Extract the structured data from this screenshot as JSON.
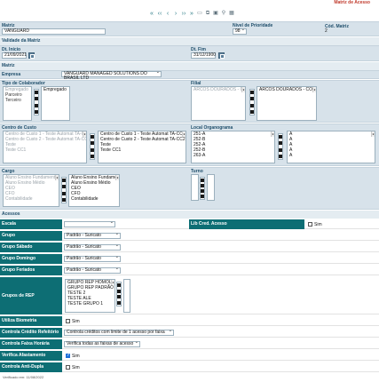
{
  "header": {
    "title": "Matriz de Acesso"
  },
  "toolbar": {
    "first": "«",
    "prev2": "‹‹",
    "prev": "‹",
    "next": "›",
    "next2": "››",
    "last": "»",
    "new_doc_icon": "document-icon",
    "copy_icon": "copy-icon",
    "save_icon": "save-icon",
    "search_icon": "search-icon",
    "export_icon": "export-icon"
  },
  "matriz": {
    "label": "Matriz",
    "value": "VANGUARD"
  },
  "nivel": {
    "label": "Nível de Prioridade",
    "value": "98"
  },
  "cod_matriz": {
    "label": "Cód. Matriz",
    "value": "2"
  },
  "validade": {
    "label": "Validade da Matriz"
  },
  "dt_inicio": {
    "label": "Dt. Início",
    "value": "21/09/2021"
  },
  "dt_fim": {
    "label": "Dt. Fim",
    "value": "31/12/1900"
  },
  "matriz_section": {
    "label": "Matriz"
  },
  "empresa": {
    "label": "Empresa",
    "value": "VANGUARD MANAGED SOLUTIONS DO BRASIL LTD"
  },
  "tipo_colab": {
    "label": "Tipo de Colaborador",
    "available": [
      "Empregado",
      "Parceiro",
      "Terceiro"
    ],
    "selected": [
      "Empregado"
    ]
  },
  "filial": {
    "label": "Filial",
    "available": [
      "ARCOS DOURADOS - CORP"
    ],
    "selected": [
      "ARCOS DOURADOS - CORP"
    ]
  },
  "centro_custo": {
    "label": "Centro de Custo",
    "available": [
      "Centro de Custo 1 - Teste Automat TA-CC1",
      "Centro de Custo 2 - Teste Automat TA-CC2",
      "Teste",
      "Teste CC1"
    ],
    "selected": [
      "Centro de Custo 1 - Teste Automat TA-CC1",
      "Centro de Custo 2 - Teste Automat TA-CC2",
      "Teste",
      "Teste CC1"
    ]
  },
  "local_org": {
    "label": "Local Organograma",
    "available": [
      "251-A",
      "252-B",
      "252-A",
      "252-B",
      "263-A"
    ],
    "selected": [
      "A",
      "A",
      "A",
      "A",
      "A"
    ]
  },
  "cargo": {
    "label": "Cargo",
    "available": [
      "Aluno Ensino Fundamental",
      "Aluno Ensino Médio",
      "CEO",
      "CFO",
      "Contabilidade"
    ],
    "selected": [
      "Aluno Ensino Fundamental",
      "Aluno Ensino Médio",
      "CEO",
      "CFO",
      "Contabilidade"
    ]
  },
  "turno": {
    "label": "Turno"
  },
  "acessos": {
    "label": "Acessos"
  },
  "escala": {
    "label": "Escala",
    "value": ""
  },
  "lib_cred": {
    "label": "Lib Cred. Acesso",
    "check_label": "Sim"
  },
  "grupo": {
    "label": "Grupo",
    "value": "Padrão - Suricato"
  },
  "grupo_sabado": {
    "label": "Grupo Sábado",
    "value": "Padrão - Suricato"
  },
  "grupo_domingo": {
    "label": "Grupo Domingo",
    "value": "Padrão - Suricato"
  },
  "grupo_feriados": {
    "label": "Grupo Feriados",
    "value": "Padrão - Suricato"
  },
  "grupos_rep": {
    "label": "Grupos de REP",
    "items": [
      "GRUPO REP HOMOLOG",
      "GRUPO REP PADRÃO",
      "TESTE 2",
      "TESTE ALE",
      "TESTE GRUPO 1"
    ]
  },
  "biometria": {
    "label": "Utiliza Biometria",
    "check_label": "Sim",
    "checked": false
  },
  "ctrl_credito": {
    "label": "Controla Crédito Refeitório",
    "value": "Controla créditos com limite de 1 acesso por faixa"
  },
  "ctrl_faixa": {
    "label": "Controla Faixa Horária",
    "value": "Verifica todas as faixas de acesso"
  },
  "afastamento": {
    "label": "Verifica Afastamento",
    "check_label": "Sim",
    "checked": true
  },
  "anti_dupla": {
    "label": "Controla Anti-Dupla",
    "check_label": "Sim",
    "checked": false
  },
  "footer": {
    "text": "Verificado em: 11/08/2022"
  }
}
